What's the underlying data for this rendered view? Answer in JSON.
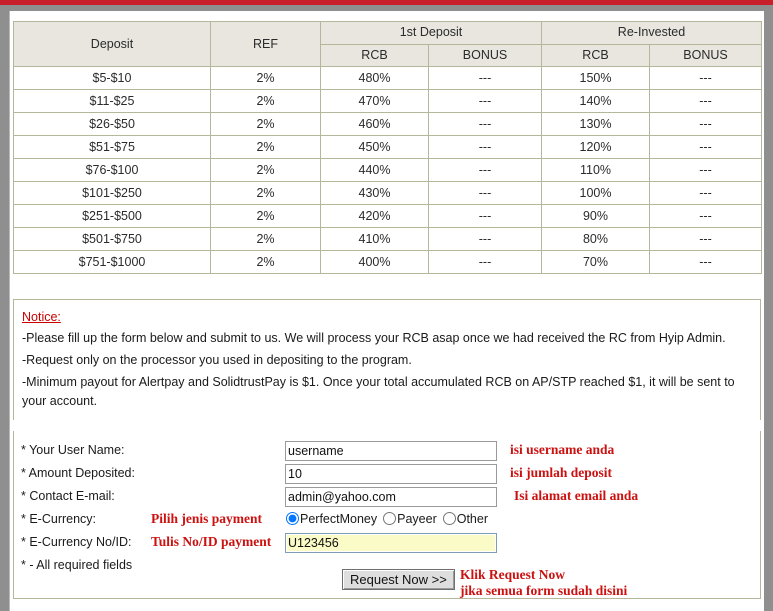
{
  "chrome": {
    "accent_red": "#c8202a",
    "rail_gray": "#8f8f8f"
  },
  "rates_table": {
    "headers": {
      "deposit": "Deposit",
      "ref": "REF",
      "first_deposit": "1st Deposit",
      "re_invested": "Re-Invested",
      "rcb": "RCB",
      "bonus": "BONUS"
    },
    "rows": [
      {
        "deposit": "$5-$10",
        "ref": "2%",
        "first_rcb": "480%",
        "first_bonus": "---",
        "re_rcb": "150%",
        "re_bonus": "---"
      },
      {
        "deposit": "$11-$25",
        "ref": "2%",
        "first_rcb": "470%",
        "first_bonus": "---",
        "re_rcb": "140%",
        "re_bonus": "---"
      },
      {
        "deposit": "$26-$50",
        "ref": "2%",
        "first_rcb": "460%",
        "first_bonus": "---",
        "re_rcb": "130%",
        "re_bonus": "---"
      },
      {
        "deposit": "$51-$75",
        "ref": "2%",
        "first_rcb": "450%",
        "first_bonus": "---",
        "re_rcb": "120%",
        "re_bonus": "---"
      },
      {
        "deposit": "$76-$100",
        "ref": "2%",
        "first_rcb": "440%",
        "first_bonus": "---",
        "re_rcb": "110%",
        "re_bonus": "---"
      },
      {
        "deposit": "$101-$250",
        "ref": "2%",
        "first_rcb": "430%",
        "first_bonus": "---",
        "re_rcb": "100%",
        "re_bonus": "---"
      },
      {
        "deposit": "$251-$500",
        "ref": "2%",
        "first_rcb": "420%",
        "first_bonus": "---",
        "re_rcb": "90%",
        "re_bonus": "---"
      },
      {
        "deposit": "$501-$750",
        "ref": "2%",
        "first_rcb": "410%",
        "first_bonus": "---",
        "re_rcb": "80%",
        "re_bonus": "---"
      },
      {
        "deposit": "$751-$1000",
        "ref": "2%",
        "first_rcb": "400%",
        "first_bonus": "---",
        "re_rcb": "70%",
        "re_bonus": "---"
      }
    ]
  },
  "notice": {
    "title": "Notice:",
    "lines": [
      "-Please fill up the form below and submit to us. We will process your RCB asap once we had received the RC from Hyip Admin.",
      "-Request only on the processor you used in depositing to the program.",
      "-Minimum payout for Alertpay and SolidtrustPay is $1. Once your total accumulated RCB on AP/STP reached $1, it will be sent to your account."
    ]
  },
  "form": {
    "username": {
      "label": "* Your User Name:",
      "value": "username",
      "placeholder": "",
      "note": "isi username anda"
    },
    "amount": {
      "label": "* Amount Deposited:",
      "value": "10",
      "placeholder": "",
      "note": "isi jumlah deposit"
    },
    "email": {
      "label": "* Contact E-mail:",
      "value": "admin@yahoo.com",
      "placeholder": "",
      "note": "Isi alamat email anda"
    },
    "ecurrency": {
      "label": "* E-Currency:",
      "note": "Pilih jenis payment",
      "options": [
        {
          "label": "PerfectMoney",
          "selected": true
        },
        {
          "label": "Payeer",
          "selected": false
        },
        {
          "label": "Other",
          "selected": false
        }
      ]
    },
    "ecurrency_id": {
      "label": "* E-Currency No/ID:",
      "note": "Tulis No/ID payment",
      "value": "U123456",
      "placeholder": ""
    },
    "required_note": "* - All required fields",
    "submit": {
      "label": "Request Now >>",
      "note_line1": "Klik Request Now",
      "note_line2": "jika semua form sudah disini"
    }
  }
}
